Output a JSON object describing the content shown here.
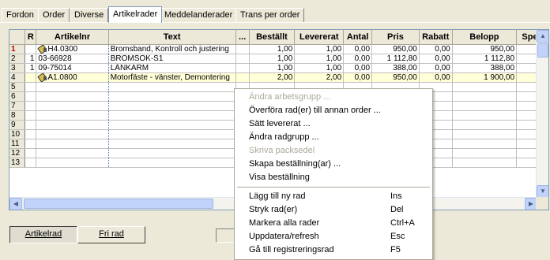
{
  "tabs": [
    {
      "label": "Fordon"
    },
    {
      "label": "Order"
    },
    {
      "label": "Diverse"
    },
    {
      "label": "Artikelrader"
    },
    {
      "label": "Meddelanderader"
    },
    {
      "label": "Trans per order"
    }
  ],
  "grid": {
    "columns": [
      "",
      "R",
      "Artikelnr",
      "Text",
      "...",
      "Beställt",
      "Levererat",
      "Antal",
      "Pris",
      "Rabatt",
      "Belopp",
      "Spec"
    ],
    "rows": [
      {
        "num": "1",
        "r": "",
        "icon": "tool-icon",
        "artikelnr": "H4.0300",
        "text": "Bromsband, Kontroll och justering",
        "bestallt": "1,00",
        "levererat": "1,00",
        "antal": "0,00",
        "pris": "950,00",
        "rabatt": "0,00",
        "belopp": "950,00"
      },
      {
        "num": "2",
        "r": "1",
        "icon": "",
        "artikelnr": "03-66928",
        "text": "BROMSOK-S1",
        "bestallt": "1,00",
        "levererat": "1,00",
        "antal": "0,00",
        "pris": "1 112,80",
        "rabatt": "0,00",
        "belopp": "1 112,80"
      },
      {
        "num": "3",
        "r": "1",
        "icon": "",
        "artikelnr": "09-75014",
        "text": "LÄNKARM",
        "bestallt": "1,00",
        "levererat": "1,00",
        "antal": "0,00",
        "pris": "388,00",
        "rabatt": "0,00",
        "belopp": "388,00"
      },
      {
        "num": "4",
        "r": "",
        "icon": "tool-icon",
        "artikelnr": "A1.0800",
        "text": "Motorfäste - vänster, Demontering",
        "bestallt": "2,00",
        "levererat": "2,00",
        "antal": "0,00",
        "pris": "950,00",
        "rabatt": "0,00",
        "belopp": "1 900,00"
      },
      {
        "num": "5"
      },
      {
        "num": "6"
      },
      {
        "num": "7"
      },
      {
        "num": "8"
      },
      {
        "num": "9"
      },
      {
        "num": "10"
      },
      {
        "num": "11"
      },
      {
        "num": "12"
      },
      {
        "num": "13"
      }
    ]
  },
  "buttons": {
    "artikelrad": "Artikelrad",
    "frirad": "Fri rad"
  },
  "menu": {
    "items": [
      {
        "label": "Ändra arbetsgrupp ...",
        "shortcut": "",
        "enabled": false
      },
      {
        "label": "Överföra rad(er) till annan order ...",
        "shortcut": "",
        "enabled": true
      },
      {
        "label": "Sätt levererat ...",
        "shortcut": "",
        "enabled": true
      },
      {
        "label": "Ändra radgrupp ...",
        "shortcut": "",
        "enabled": true
      },
      {
        "label": "Skriva packsedel",
        "shortcut": "",
        "enabled": false
      },
      {
        "label": "Skapa beställning(ar) ...",
        "shortcut": "",
        "enabled": true
      },
      {
        "label": "Visa beställning",
        "shortcut": "",
        "enabled": true
      },
      {
        "label": "Lägg till ny rad",
        "shortcut": "Ins",
        "enabled": true
      },
      {
        "label": "Stryk rad(er)",
        "shortcut": "Del",
        "enabled": true
      },
      {
        "label": "Markera alla rader",
        "shortcut": "Ctrl+A",
        "enabled": true
      },
      {
        "label": "Uppdatera/refresh",
        "shortcut": "Esc",
        "enabled": true
      },
      {
        "label": "Gå till registreringsrad",
        "shortcut": "F5",
        "enabled": true
      }
    ]
  },
  "colors": {
    "selected_row": "#ffffd8",
    "row_marker": "#c00000",
    "window_bg": "#ece9d8"
  }
}
